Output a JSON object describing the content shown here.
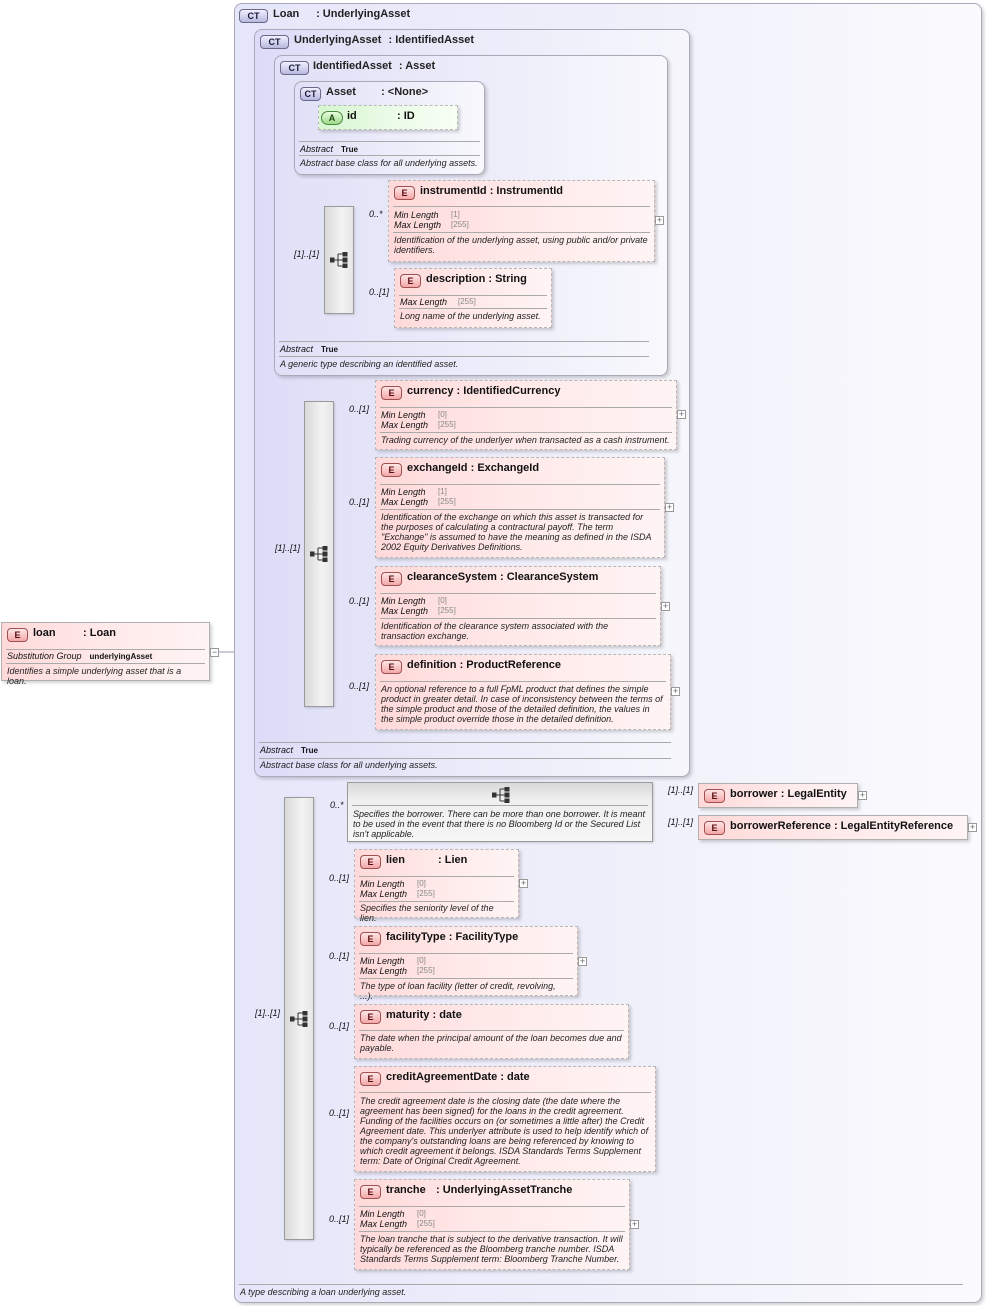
{
  "root": {
    "badge": "CT",
    "name": "Loan",
    "type": ": UnderlyingAsset",
    "doc": "A type describing a loan underlying asset."
  },
  "underlying": {
    "badge": "CT",
    "name": "UnderlyingAsset",
    "type": ": IdentifiedAsset",
    "abstract_label": "Abstract",
    "abstract_value": "True",
    "doc": "Abstract base class for all underlying assets."
  },
  "identified": {
    "badge": "CT",
    "name": "IdentifiedAsset",
    "type": ": Asset",
    "abstract_label": "Abstract",
    "abstract_value": "True",
    "doc": "A generic type describing an identified asset."
  },
  "asset": {
    "badge": "CT",
    "name": "Asset",
    "type": ": <None>",
    "abstract_label": "Abstract",
    "abstract_value": "True",
    "doc": "Abstract base class for all underlying assets.",
    "attr": {
      "badge": "A",
      "name": "id",
      "type": ": ID"
    }
  },
  "loan_element": {
    "badge": "E",
    "name": "loan",
    "type": ": Loan",
    "sg_label": "Substitution Group",
    "sg_value": "underlyingAsset",
    "doc": "Identifies a simple underlying asset that is a loan."
  },
  "labels": {
    "min_length": "Min Length",
    "max_length": "Max Length",
    "e": "E"
  },
  "elements": {
    "instrumentId": {
      "name": "instrumentId",
      "type": ": InstrumentId",
      "card": "0..*",
      "min": "[1]",
      "max": "[255]",
      "doc": "Identification of the underlying asset, using public and/or private identifiers."
    },
    "description": {
      "name": "description",
      "type": ": String",
      "card": "0..[1]",
      "max": "[255]",
      "doc": "Long name of the underlying asset."
    },
    "currency": {
      "name": "currency",
      "type": ": IdentifiedCurrency",
      "card": "0..[1]",
      "min": "[0]",
      "max": "[255]",
      "doc": "Trading currency of the underlyer when transacted as a cash instrument."
    },
    "exchangeId": {
      "name": "exchangeId",
      "type": ": ExchangeId",
      "card": "0..[1]",
      "min": "[1]",
      "max": "[255]",
      "doc": "Identification of the exchange on which this asset is transacted for the purposes of calculating a contractural payoff. The term \"Exchange\" is assumed to have the meaning as defined in the ISDA 2002 Equity Derivatives Definitions."
    },
    "clearanceSystem": {
      "name": "clearanceSystem",
      "type": ": ClearanceSystem",
      "card": "0..[1]",
      "min": "[0]",
      "max": "[255]",
      "doc": "Identification of the clearance system associated with the transaction exchange."
    },
    "definition": {
      "name": "definition",
      "type": ": ProductReference",
      "card": "0..[1]",
      "doc": "An optional reference to a full FpML product that defines the simple product in greater detail. In case of inconsistency between the terms of the simple product and those of the detailed definition, the values in the simple product override those in the detailed definition."
    },
    "borrower": {
      "name": "borrower",
      "type": ": LegalEntity",
      "card": "[1]..[1]"
    },
    "borrowerReference": {
      "name": "borrowerReference",
      "type": ": LegalEntityReference",
      "card": "[1]..[1]"
    },
    "lien": {
      "name": "lien",
      "type": ": Lien",
      "card": "0..[1]",
      "min": "[0]",
      "max": "[255]",
      "doc": "Specifies the seniority level of the lien."
    },
    "facilityType": {
      "name": "facilityType",
      "type": ": FacilityType",
      "card": "0..[1]",
      "min": "[0]",
      "max": "[255]",
      "doc": "The type of loan facility (letter of credit, revolving, ...)."
    },
    "maturity": {
      "name": "maturity",
      "type": ": date",
      "card": "0..[1]",
      "doc": "The date when the principal amount of the loan becomes due and payable."
    },
    "creditAgreementDate": {
      "name": "creditAgreementDate",
      "type": ": date",
      "card": "0..[1]",
      "doc": "The credit agreement date is the closing date (the date where the agreement has been signed) for the loans in the credit agreement. Funding of the facilities occurs on (or sometimes a little after) the Credit Agreement date. This underlyer attribute is used to help identify which of the company's outstanding loans are being referenced by knowing to which credit agreement it belongs. ISDA Standards Terms Supplement term: Date of Original Credit Agreement."
    },
    "tranche": {
      "name": "tranche",
      "type": ": UnderlyingAssetTranche",
      "card": "0..[1]",
      "min": "[0]",
      "max": "[255]",
      "doc": "The loan tranche that is subject to the derivative transaction. It will typically be referenced as the Bloomberg tranche number. ISDA Standards Terms Supplement term: Bloomberg Tranche Number."
    }
  },
  "choice": {
    "card": "0..*",
    "doc": "Specifies the borrower. There can be more than one borrower. It is meant to be used in the event that there is no Bloomberg Id or the Secured List isn't applicable."
  },
  "sequences": {
    "seq_identified": {
      "card": "[1]..[1]"
    },
    "seq_underlying": {
      "card": "[1]..[1]"
    },
    "seq_loan": {
      "card": "[1]..[1]"
    }
  }
}
